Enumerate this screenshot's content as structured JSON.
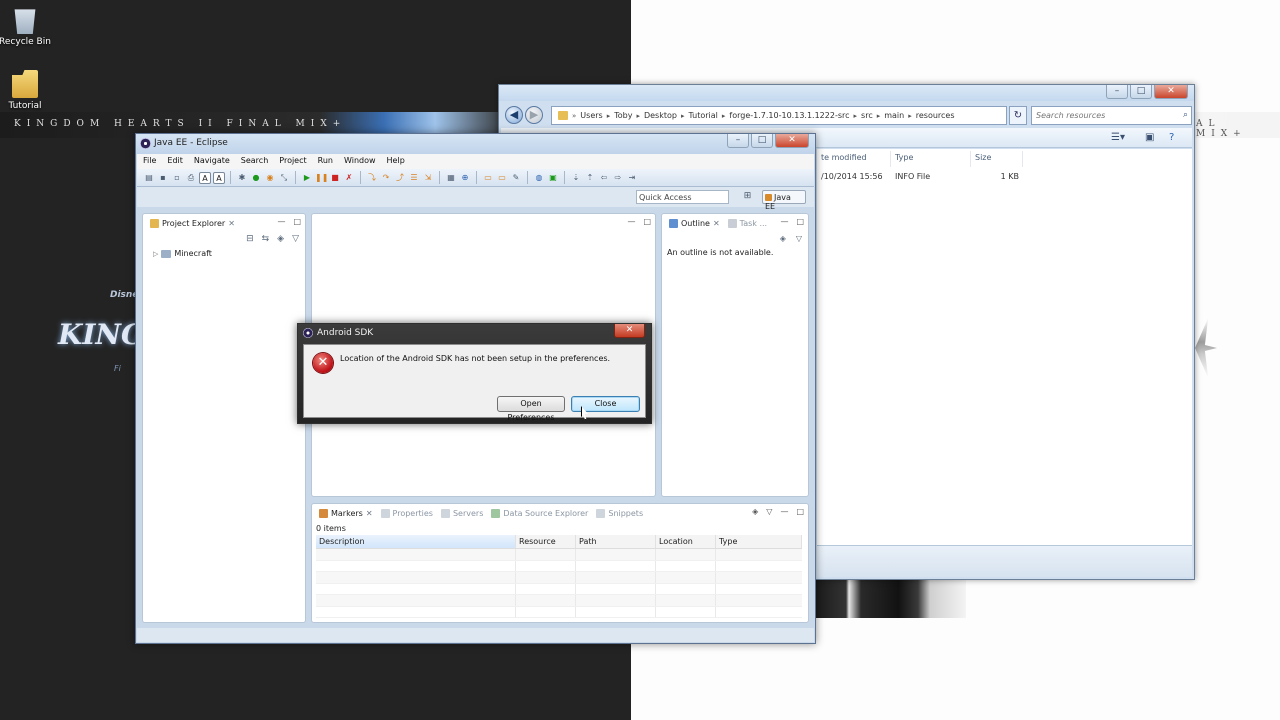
{
  "desktop": {
    "wallpaper_title": "KINGDOM HEARTS II FINAL MIX+",
    "wallpaper_title_right": "AL MIX+",
    "logo_text": "KINGD",
    "logo_disney": "Disney",
    "logo_sub": "Fi",
    "icons": [
      {
        "label": "Recycle Bin"
      },
      {
        "label": "Tutorial"
      }
    ]
  },
  "explorer": {
    "breadcrumbs": [
      "Users",
      "Toby",
      "Desktop",
      "Tutorial",
      "forge-1.7.10-10.13.1.1222-src",
      "src",
      "main",
      "resources"
    ],
    "search_placeholder": "Search resources",
    "columns": [
      "te modified",
      "Type",
      "Size"
    ],
    "files": [
      {
        "modified": "/10/2014 15:56",
        "type": "INFO File",
        "size": "1 KB"
      }
    ]
  },
  "eclipse": {
    "title": "Java EE - Eclipse",
    "menu": [
      "File",
      "Edit",
      "Navigate",
      "Search",
      "Project",
      "Run",
      "Window",
      "Help"
    ],
    "quick_access": "Quick Access",
    "perspective": "Java EE",
    "project_explorer": {
      "tab_label": "Project Explorer",
      "items": [
        {
          "label": "Minecraft"
        }
      ]
    },
    "outline": {
      "tab_label": "Outline",
      "tab_task": "Task ...",
      "message": "An outline is not available."
    },
    "bottom_tabs": [
      "Markers",
      "Properties",
      "Servers",
      "Data Source Explorer",
      "Snippets"
    ],
    "markers": {
      "count": "0 items",
      "columns": [
        "Description",
        "Resource",
        "Path",
        "Location",
        "Type"
      ]
    }
  },
  "dialog": {
    "title": "Android SDK",
    "message": "Location of the Android SDK has not been setup in the preferences.",
    "buttons": {
      "open_preferences": "Open Preferences",
      "close": "Close"
    }
  },
  "colors": {
    "error_red": "#c0141a",
    "accent_blue": "#3c7fb1",
    "window_frame": "#c9d9ea"
  }
}
